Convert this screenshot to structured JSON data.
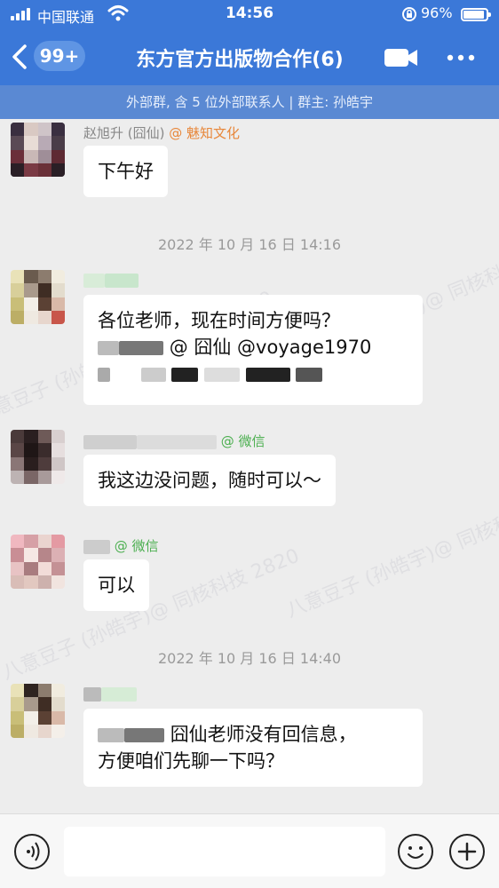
{
  "status_bar": {
    "carrier": "中国联通",
    "time": "14:56",
    "battery": "96%"
  },
  "header": {
    "back_badge": "99+",
    "title": "东方官方出版物合作(6)"
  },
  "subheader": {
    "text": "外部群, 含 5 位外部联系人 | 群主: 孙皓宇"
  },
  "messages": [
    {
      "sender_name": "赵旭升 (囧仙)",
      "sender_tag": "@ 魅知文化",
      "text": "下午好"
    },
    {
      "timestamp": "2022 年 10 月 16 日  14:16"
    },
    {
      "sender_name": "",
      "sender_tag": "",
      "line1": "各位老师，现在时间方便吗？",
      "line2_mentions": "@ 囧仙 @voyage1970",
      "line3": ""
    },
    {
      "sender_name": "",
      "sender_tag": "@ 微信",
      "text": "我这边没问题，随时可以～"
    },
    {
      "sender_name": "",
      "sender_tag": "@ 微信",
      "text": "可以"
    },
    {
      "timestamp": "2022 年 10 月 16 日  14:40"
    },
    {
      "sender_name": "",
      "sender_tag": "",
      "line1": "囧仙老师没有回信息，",
      "line2": "方便咱们先聊一下吗？"
    }
  ],
  "watermarks": [
    "八意豆子 (孙皓宇)@ 同核科技 2820",
    "八意豆子 (孙皓宇)@ 同核科技 2820",
    "八意豆子 (孙皓宇)@ 同核科技 2820",
    "八意豆子 (孙皓宇)@ 同核科技 2820"
  ],
  "input": {
    "placeholder": ""
  },
  "colors": {
    "header_bg": "#3b78d8",
    "subheader_bg": "#5a89d3",
    "chat_bg": "#ededed",
    "org_tag": "#e8873a",
    "wechat_tag": "#4caf50"
  }
}
